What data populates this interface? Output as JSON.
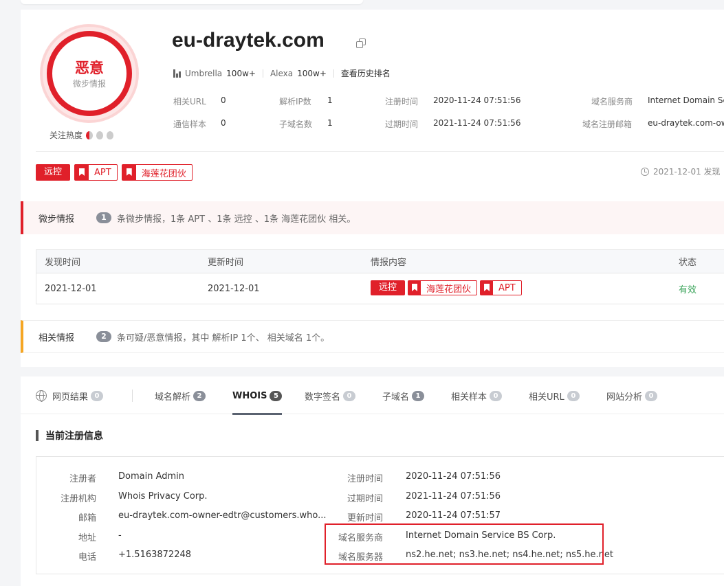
{
  "badge": {
    "verdict": "恶意",
    "source": "微步情报",
    "heat_label": "关注热度"
  },
  "domain": "eu-draytek.com",
  "ranks": {
    "umbrella_label": "Umbrella",
    "umbrella_value": "100w+",
    "alexa_label": "Alexa",
    "alexa_value": "100w+",
    "history_link": "查看历史排名"
  },
  "meta": {
    "related_url_label": "相关URL",
    "related_url_value": "0",
    "ip_count_label": "解析IP数",
    "ip_count_value": "1",
    "reg_time_label": "注册时间",
    "reg_time_value": "2020-11-24 07:51:56",
    "registrar_label": "域名服务商",
    "registrar_value": "Internet Domain Se",
    "samples_label": "通信样本",
    "samples_value": "0",
    "subdomain_label": "子域名数",
    "subdomain_value": "1",
    "expire_label": "过期时间",
    "expire_value": "2021-11-24 07:51:56",
    "email_label": "域名注册邮箱",
    "email_value": "eu-draytek.com-ow"
  },
  "tags": {
    "remote": "远控",
    "apt": "APT",
    "group": "海莲花团伙"
  },
  "found_text": "2021-12-01 发现",
  "intel": {
    "label": "微步情报",
    "count": "1",
    "text": "条微步情报，1条 APT 、1条 远控 、1条 海莲花团伙 相关。"
  },
  "table": {
    "headers": [
      "发现时间",
      "更新时间",
      "情报内容",
      "状态"
    ],
    "row": {
      "found": "2021-12-01",
      "updated": "2021-12-01",
      "status": "有效"
    }
  },
  "related": {
    "label": "相关情报",
    "count": "2",
    "text": "条可疑/恶意情报，其中 解析IP 1个、 相关域名 1个。"
  },
  "tabs": [
    {
      "label": "网页结果",
      "count": "0"
    },
    {
      "label": "域名解析",
      "count": "2"
    },
    {
      "label": "WHOIS",
      "count": "5"
    },
    {
      "label": "数字签名",
      "count": "0"
    },
    {
      "label": "子域名",
      "count": "1"
    },
    {
      "label": "相关样本",
      "count": "0"
    },
    {
      "label": "相关URL",
      "count": "0"
    },
    {
      "label": "网站分析",
      "count": "0"
    }
  ],
  "whois": {
    "title": "当前注册信息",
    "left": [
      {
        "k": "注册者",
        "v": "Domain Admin"
      },
      {
        "k": "注册机构",
        "v": "Whois Privacy Corp."
      },
      {
        "k": "邮箱",
        "v": "eu-draytek.com-owner-edtr@customers.who..."
      },
      {
        "k": "地址",
        "v": "-"
      },
      {
        "k": "电话",
        "v": "+1.5163872248"
      }
    ],
    "right": [
      {
        "k": "注册时间",
        "v": "2020-11-24 07:51:56"
      },
      {
        "k": "过期时间",
        "v": "2021-11-24 07:51:56"
      },
      {
        "k": "更新时间",
        "v": "2020-11-24 07:51:57"
      },
      {
        "k": "域名服务商",
        "v": "Internet Domain Service BS Corp."
      },
      {
        "k": "域名服务器",
        "v": "ns2.he.net; ns3.he.net; ns4.he.net; ns5.he.net"
      }
    ]
  },
  "colors": {
    "accent_red": "#e0202a",
    "warning_orange": "#f5a623",
    "ok_green": "#3ca55c"
  }
}
